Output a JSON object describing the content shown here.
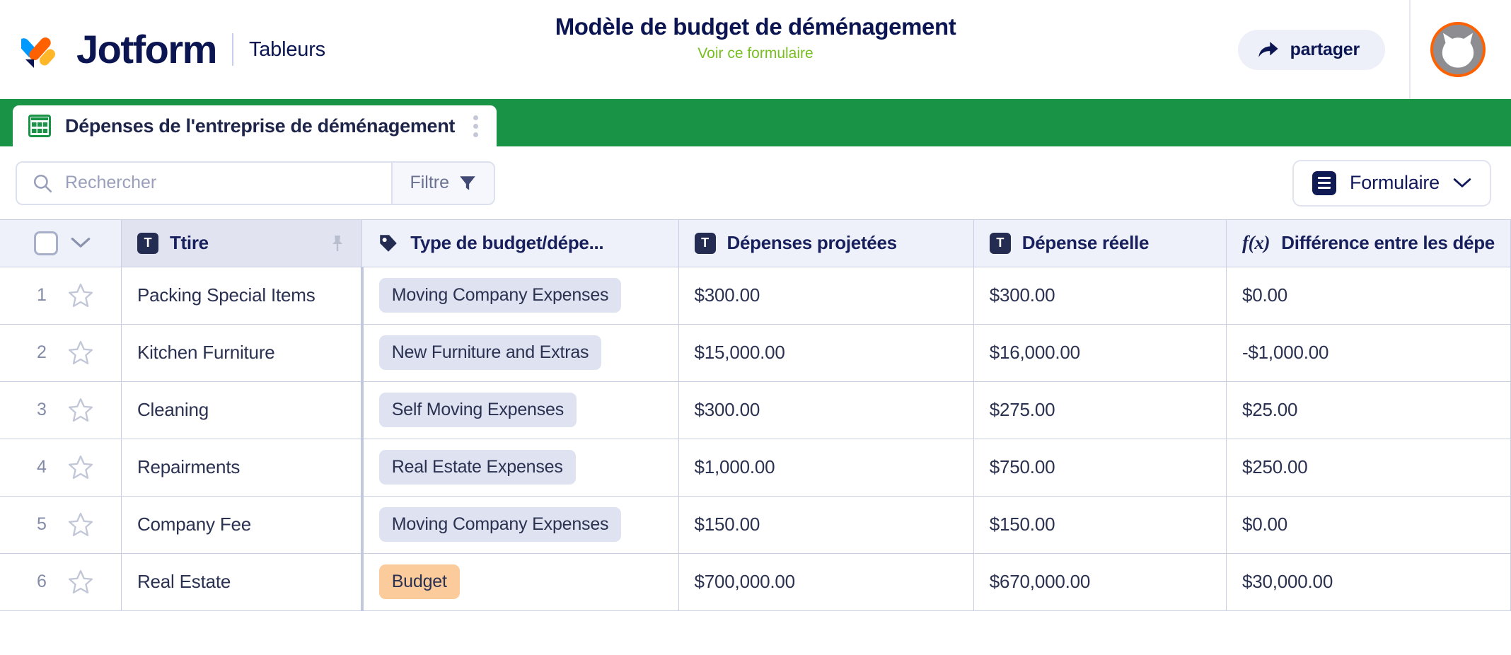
{
  "header": {
    "brand_name": "Jotform",
    "brand_section": "Tableurs",
    "title": "Modèle de budget de déménagement",
    "subtitle_link": "Voir ce formulaire",
    "share_label": "partager",
    "share_icon": "share-arrow-icon",
    "avatar_icon": "user-avatar-cat-icon",
    "accent_green": "#78BE20",
    "brand_navy": "#0A1551",
    "avatar_ring": "#FF6100"
  },
  "tabs": {
    "bar_color": "#199346",
    "items": [
      {
        "label": "Dépenses de l'entreprise de déménagement",
        "icon": "grid-table-icon",
        "menu_icon": "kebab-menu-icon",
        "active": true
      }
    ]
  },
  "toolbar": {
    "search_placeholder": "Rechercher",
    "search_value": "",
    "search_icon": "search-icon",
    "filter_label": "Filtre",
    "filter_icon": "funnel-icon",
    "view_label": "Formulaire",
    "view_icon": "form-icon",
    "view_chevron": "chevron-down-icon"
  },
  "table": {
    "select_all_checkbox": false,
    "columns": [
      {
        "label": "Ttire",
        "icon": "text-field-icon",
        "pinned": true,
        "pin_icon": "pin-icon"
      },
      {
        "label": "Type de budget/dépe...",
        "icon": "tag-icon",
        "pinned": false
      },
      {
        "label": "Dépenses projetées",
        "icon": "text-field-icon",
        "pinned": false
      },
      {
        "label": "Dépense réelle",
        "icon": "text-field-icon",
        "pinned": false
      },
      {
        "label": "Différence entre les dépe",
        "icon": "formula-fx-icon",
        "pinned": false
      }
    ],
    "rows": [
      {
        "num": "1",
        "star": "star-outline-icon",
        "title": "Packing Special Items",
        "type": "Moving Company Expenses",
        "type_color": "default",
        "projected": "$300.00",
        "actual": "$300.00",
        "difference": "$0.00"
      },
      {
        "num": "2",
        "star": "star-outline-icon",
        "title": "Kitchen Furniture",
        "type": "New Furniture and Extras",
        "type_color": "default",
        "projected": "$15,000.00",
        "actual": "$16,000.00",
        "difference": "-$1,000.00"
      },
      {
        "num": "3",
        "star": "star-outline-icon",
        "title": "Cleaning",
        "type": "Self Moving Expenses",
        "type_color": "default",
        "projected": "$300.00",
        "actual": "$275.00",
        "difference": "$25.00"
      },
      {
        "num": "4",
        "star": "star-outline-icon",
        "title": "Repairments",
        "type": "Real Estate Expenses",
        "type_color": "default",
        "projected": "$1,000.00",
        "actual": "$750.00",
        "difference": "$250.00"
      },
      {
        "num": "5",
        "star": "star-outline-icon",
        "title": "Company Fee",
        "type": "Moving Company Expenses",
        "type_color": "default",
        "projected": "$150.00",
        "actual": "$150.00",
        "difference": "$0.00"
      },
      {
        "num": "6",
        "star": "star-outline-icon",
        "title": "Real Estate",
        "type": "Budget",
        "type_color": "orange",
        "projected": "$700,000.00",
        "actual": "$670,000.00",
        "difference": "$30,000.00"
      }
    ]
  }
}
